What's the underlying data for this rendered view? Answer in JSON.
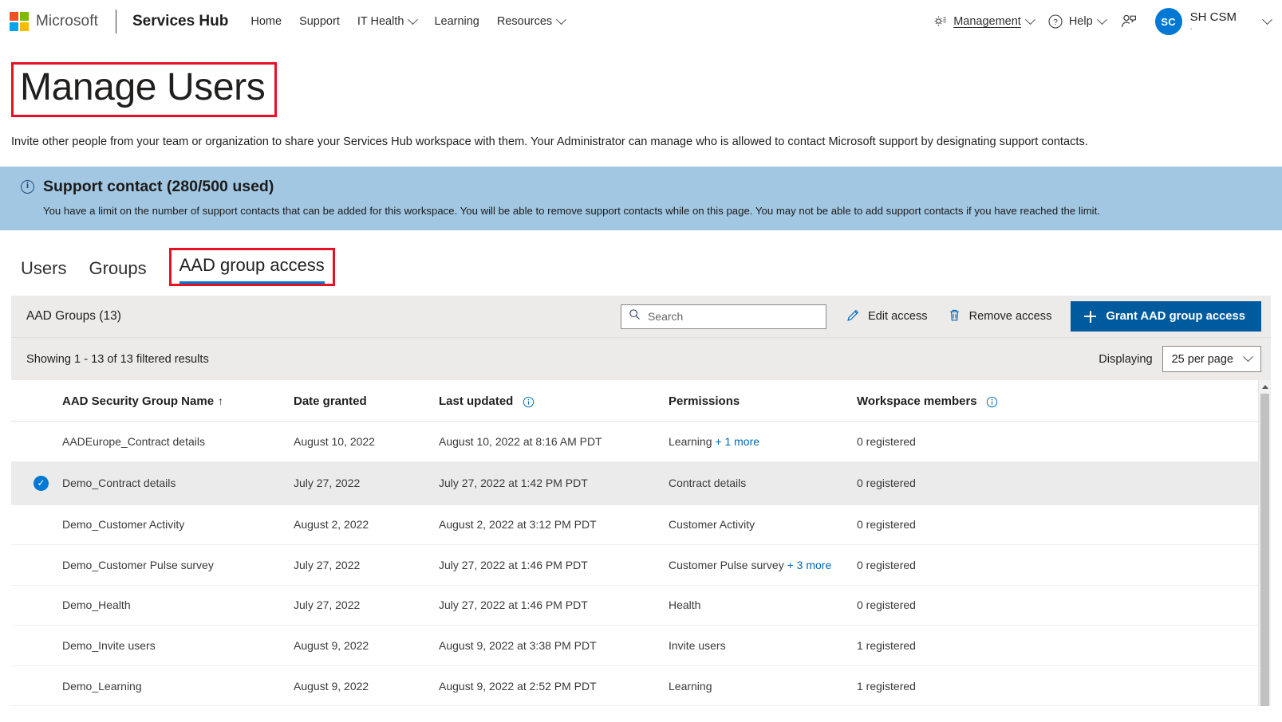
{
  "topnav": {
    "brand": "Microsoft",
    "app_name": "Services Hub",
    "links": [
      {
        "label": "Home",
        "has_chevron": false
      },
      {
        "label": "Support",
        "has_chevron": false
      },
      {
        "label": "IT Health",
        "has_chevron": true
      },
      {
        "label": "Learning",
        "has_chevron": false
      },
      {
        "label": "Resources",
        "has_chevron": true
      }
    ],
    "management_label": "Management",
    "help_label": "Help",
    "avatar_initials": "SC",
    "user_name": "SH CSM",
    "user_sub": "."
  },
  "page": {
    "title": "Manage Users",
    "description": "Invite other people from your team or organization to share your Services Hub workspace with them. Your Administrator can manage who is allowed to contact Microsoft support by designating support contacts."
  },
  "banner": {
    "heading": "Support contact (280/500 used)",
    "body": "You have a limit on the number of support contacts that can be added for this workspace. You will be able to remove support contacts while on this page. You may not be able to add support contacts if you have reached the limit.",
    "background": "#a2c7e2"
  },
  "tabs": {
    "items": [
      {
        "label": "Users",
        "active": false
      },
      {
        "label": "Groups",
        "active": false
      }
    ],
    "active_tab": "AAD group access"
  },
  "toolbar": {
    "title": "AAD Groups (13)",
    "search_placeholder": "Search",
    "search_value": "",
    "edit_access_label": "Edit access",
    "remove_access_label": "Remove access",
    "grant_label": "Grant AAD group access",
    "primary_color": "#005a9e"
  },
  "results": {
    "showing_text": "Showing 1 - 13 of 13 filtered results",
    "displaying_label": "Displaying",
    "per_page_value": "25 per page"
  },
  "table": {
    "headers": {
      "name": "AAD Security Group Name",
      "sort_arrow": "↑",
      "date_granted": "Date granted",
      "last_updated": "Last updated",
      "permissions": "Permissions",
      "workspace_members": "Workspace members"
    },
    "rows": [
      {
        "selected": false,
        "name": "AADEurope_Contract details",
        "date_granted": "August 10, 2022",
        "last_updated": "August 10, 2022 at 8:16 AM PDT",
        "permission": "Learning",
        "permission_more": "+ 1 more",
        "members": "0 registered"
      },
      {
        "selected": true,
        "name": "Demo_Contract details",
        "date_granted": "July 27, 2022",
        "last_updated": "July 27, 2022 at 1:42 PM PDT",
        "permission": "Contract details",
        "permission_more": "",
        "members": "0 registered"
      },
      {
        "selected": false,
        "name": "Demo_Customer Activity",
        "date_granted": "August 2, 2022",
        "last_updated": "August 2, 2022 at 3:12 PM PDT",
        "permission": "Customer Activity",
        "permission_more": "",
        "members": "0 registered"
      },
      {
        "selected": false,
        "name": "Demo_Customer Pulse survey",
        "date_granted": "July 27, 2022",
        "last_updated": "July 27, 2022 at 1:46 PM PDT",
        "permission": "Customer Pulse survey",
        "permission_more": "+ 3 more",
        "members": "0 registered"
      },
      {
        "selected": false,
        "name": "Demo_Health",
        "date_granted": "July 27, 2022",
        "last_updated": "July 27, 2022 at 1:46 PM PDT",
        "permission": "Health",
        "permission_more": "",
        "members": "0 registered"
      },
      {
        "selected": false,
        "name": "Demo_Invite users",
        "date_granted": "August 9, 2022",
        "last_updated": "August 9, 2022 at 3:38 PM PDT",
        "permission": "Invite users",
        "permission_more": "",
        "members": "1 registered"
      },
      {
        "selected": false,
        "name": "Demo_Learning",
        "date_granted": "August 9, 2022",
        "last_updated": "August 9, 2022 at 2:52 PM PDT",
        "permission": "Learning",
        "permission_more": "",
        "members": "1 registered"
      }
    ]
  },
  "logo_colors": [
    "#f25022",
    "#7fba00",
    "#00a4ef",
    "#ffb900"
  ],
  "annotation_color": "#e81123"
}
